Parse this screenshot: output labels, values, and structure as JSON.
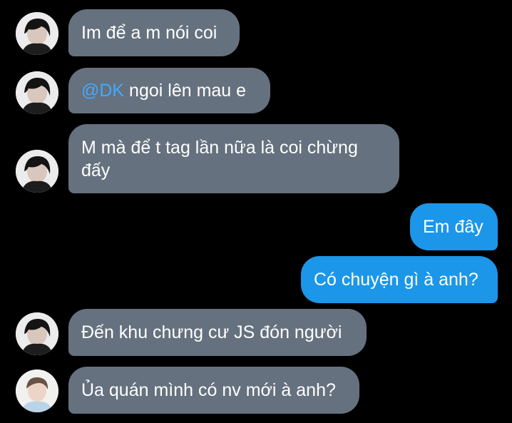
{
  "messages": [
    {
      "text": "Im để a m nói coi"
    },
    {
      "mention": "@DK",
      "text": " ngoi lên mau e"
    },
    {
      "text": "M mà để t tag lần nữa là coi chừng đấy"
    },
    {
      "text": "Em đây"
    },
    {
      "text": "Có chuyện gì à anh?"
    },
    {
      "text": "Đến khu chưng cư JS đón người"
    },
    {
      "text": "Ủa quán mình có nv mới à anh?"
    }
  ],
  "colors": {
    "background": "#000000",
    "incoming_bubble": "#65717e",
    "outgoing_bubble": "#1c96e8",
    "mention": "#45a9ff"
  },
  "icons": [
    "avatar-dark-hair-photo",
    "avatar-light-photo"
  ]
}
